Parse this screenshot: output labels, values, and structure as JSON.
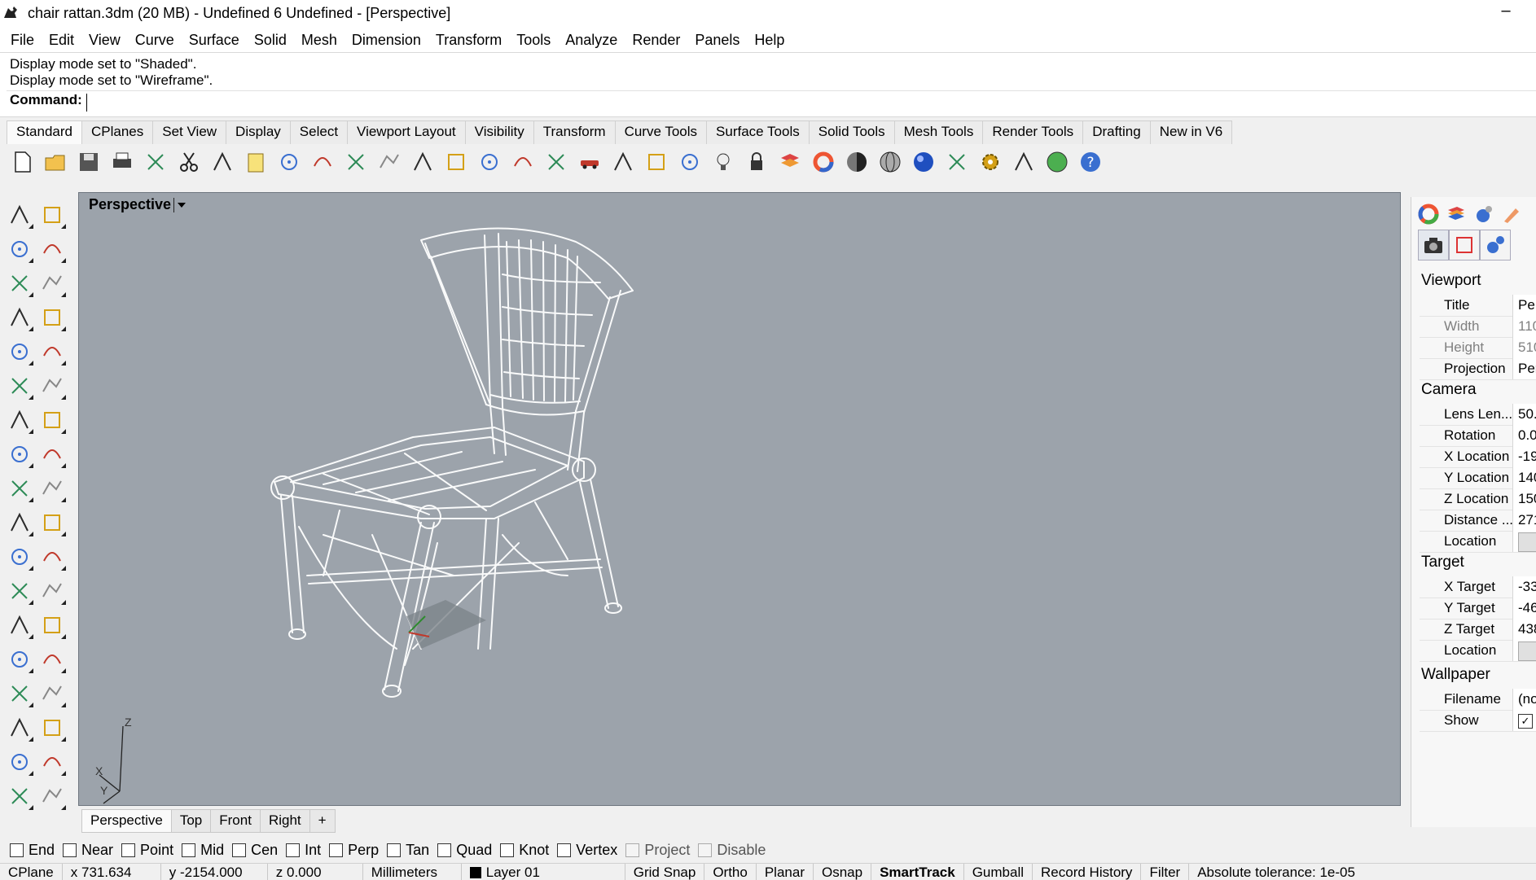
{
  "window": {
    "title": "chair rattan.3dm (20 MB) - Undefined 6 Undefined - [Perspective]",
    "minimize": "–"
  },
  "menu": [
    "File",
    "Edit",
    "View",
    "Curve",
    "Surface",
    "Solid",
    "Mesh",
    "Dimension",
    "Transform",
    "Tools",
    "Analyze",
    "Render",
    "Panels",
    "Help"
  ],
  "command": {
    "history": [
      "Display mode set to \"Shaded\".",
      "Display mode set to \"Wireframe\"."
    ],
    "prompt": "Command:",
    "value": ""
  },
  "tool_tabs": [
    {
      "label": "Standard",
      "active": true
    },
    {
      "label": "CPlanes"
    },
    {
      "label": "Set View"
    },
    {
      "label": "Display"
    },
    {
      "label": "Select"
    },
    {
      "label": "Viewport Layout"
    },
    {
      "label": "Visibility"
    },
    {
      "label": "Transform"
    },
    {
      "label": "Curve Tools"
    },
    {
      "label": "Surface Tools"
    },
    {
      "label": "Solid Tools"
    },
    {
      "label": "Mesh Tools"
    },
    {
      "label": "Render Tools"
    },
    {
      "label": "Drafting"
    },
    {
      "label": "New in V6"
    }
  ],
  "toolbar_icons": [
    "new-icon",
    "open-icon",
    "save-icon",
    "print-icon",
    "import-icon",
    "cut-icon",
    "copy-icon",
    "paste-icon",
    "undo-icon",
    "pan-icon",
    "rotate-view-icon",
    "zoom-icon",
    "zoom-window-icon",
    "zoom-extents-icon",
    "zoom-selected-icon",
    "rotate-icon",
    "four-viewports-icon",
    "car-icon",
    "grid-icon",
    "named-cplane-icon",
    "osnap-icon",
    "light-icon",
    "lock-icon",
    "layer-icon",
    "color-wheel-icon",
    "shaded-sphere-icon",
    "wireframe-sphere-icon",
    "render-sphere-icon",
    "dimension-icon",
    "settings-gear-icon",
    "ortho-icon",
    "globe-icon",
    "help-icon"
  ],
  "left_tools": [
    [
      "select-arrow-icon",
      "point-icon"
    ],
    [
      "polyline-icon",
      "curve-icon"
    ],
    [
      "circle-icon",
      "ellipse-icon"
    ],
    [
      "polygon-icon",
      "rectangle-icon"
    ],
    [
      "arc-icon",
      "fillet-curve-icon"
    ],
    [
      "surface-from-points-icon",
      "extrude-surface-icon"
    ],
    [
      "box-icon",
      "sphere-icon"
    ],
    [
      "cylinder-icon",
      "plane-surface-icon"
    ],
    [
      "explode-icon",
      "split-icon"
    ],
    [
      "trim-icon",
      "join-icon"
    ],
    [
      "boolean-union-icon",
      "group-icon"
    ],
    [
      "fillet-icon",
      "blend-icon"
    ],
    [
      "text-icon",
      "scale-icon"
    ],
    [
      "array-icon",
      "mirror-icon"
    ],
    [
      "block-icon",
      "hatch-icon"
    ],
    [
      "grid-array-icon",
      "dimension-vertical-icon"
    ],
    [
      "analyze-icon",
      "check-icon"
    ],
    [
      "solid-edit-icon",
      "cplane-icon"
    ]
  ],
  "viewport": {
    "title": "Perspective",
    "axes": {
      "x": "X",
      "y": "Y",
      "z": "Z"
    }
  },
  "viewport_tabs": [
    {
      "label": "Perspective",
      "active": true
    },
    {
      "label": "Top"
    },
    {
      "label": "Front"
    },
    {
      "label": "Right"
    },
    {
      "label": "+"
    }
  ],
  "properties": {
    "sections": [
      {
        "title": "Viewport",
        "rows": [
          {
            "key": "Title",
            "value": "Pe"
          },
          {
            "key": "Width",
            "value": "110",
            "dim": true
          },
          {
            "key": "Height",
            "value": "510",
            "dim": true
          },
          {
            "key": "Projection",
            "value": "Per"
          }
        ]
      },
      {
        "title": "Camera",
        "rows": [
          {
            "key": "Lens Len...",
            "value": "50."
          },
          {
            "key": "Rotation",
            "value": "0.0"
          },
          {
            "key": "X Location",
            "value": "-19"
          },
          {
            "key": "Y Location",
            "value": "140"
          },
          {
            "key": "Z Location",
            "value": "150"
          },
          {
            "key": "Distance ...",
            "value": "271"
          },
          {
            "key": "Location",
            "value": "",
            "button": true
          }
        ]
      },
      {
        "title": "Target",
        "rows": [
          {
            "key": "X Target",
            "value": "-33"
          },
          {
            "key": "Y Target",
            "value": "-46"
          },
          {
            "key": "Z Target",
            "value": "438"
          },
          {
            "key": "Location",
            "value": "",
            "button": true
          }
        ]
      },
      {
        "title": "Wallpaper",
        "rows": [
          {
            "key": "Filename",
            "value": "(no"
          },
          {
            "key": "Show",
            "value": "✓",
            "check": true
          }
        ]
      }
    ]
  },
  "osnaps": [
    {
      "label": "End",
      "checked": false
    },
    {
      "label": "Near",
      "checked": false
    },
    {
      "label": "Point",
      "checked": false
    },
    {
      "label": "Mid",
      "checked": false
    },
    {
      "label": "Cen",
      "checked": false
    },
    {
      "label": "Int",
      "checked": false
    },
    {
      "label": "Perp",
      "checked": false
    },
    {
      "label": "Tan",
      "checked": false
    },
    {
      "label": "Quad",
      "checked": false
    },
    {
      "label": "Knot",
      "checked": false
    },
    {
      "label": "Vertex",
      "checked": false
    },
    {
      "label": "Project",
      "checked": false,
      "dim": true
    },
    {
      "label": "Disable",
      "checked": false,
      "dim": true
    }
  ],
  "status": {
    "cplane": "CPlane",
    "x": "x 731.634",
    "y": "y -2154.000",
    "z": "z 0.000",
    "units": "Millimeters",
    "layer": "Layer 01",
    "toggles": [
      {
        "label": "Grid Snap"
      },
      {
        "label": "Ortho"
      },
      {
        "label": "Planar"
      },
      {
        "label": "Osnap"
      },
      {
        "label": "SmartTrack",
        "bold": true
      },
      {
        "label": "Gumball"
      },
      {
        "label": "Record History"
      },
      {
        "label": "Filter"
      }
    ],
    "tolerance": "Absolute tolerance: 1e-05"
  },
  "colors": {
    "viewport_bg": "#9ca3ab",
    "wire": "#ffffff"
  }
}
